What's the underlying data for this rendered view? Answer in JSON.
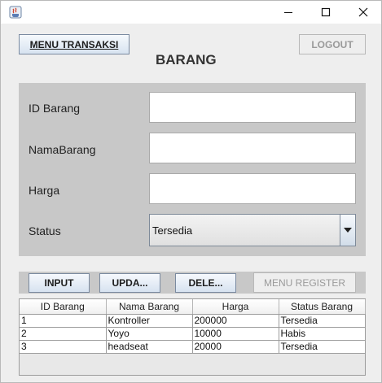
{
  "window": {
    "minimize_glyph": "—",
    "maximize_glyph": "☐",
    "close_glyph": "✕"
  },
  "header": {
    "menu_transaksi_label": "MENU TRANSAKSI",
    "logout_label": "LOGOUT",
    "title": "BARANG"
  },
  "form": {
    "id_label": "ID Barang",
    "id_value": "",
    "nama_label": "NamaBarang",
    "nama_value": "",
    "harga_label": "Harga",
    "harga_value": "",
    "status_label": "Status",
    "status_selected": "Tersedia"
  },
  "actions": {
    "input_label": "INPUT",
    "update_label": "UPDA...",
    "delete_label": "DELE...",
    "register_label": "MENU REGISTER"
  },
  "table": {
    "columns": [
      "ID Barang",
      "Nama Barang",
      "Harga",
      "Status Barang"
    ],
    "rows": [
      [
        "1",
        "Kontroller",
        "200000",
        "Tersedia"
      ],
      [
        "2",
        "Yoyo",
        "10000",
        "Habis"
      ],
      [
        "3",
        "headseat",
        "20000",
        "Tersedia"
      ]
    ]
  },
  "colors": {
    "panel": "#c8c8c8",
    "background": "#eeeeee",
    "button_border": "#7a8aa0"
  },
  "icons": [
    "java-app-icon",
    "minimize-icon",
    "maximize-icon",
    "close-icon",
    "chevron-down-icon"
  ]
}
